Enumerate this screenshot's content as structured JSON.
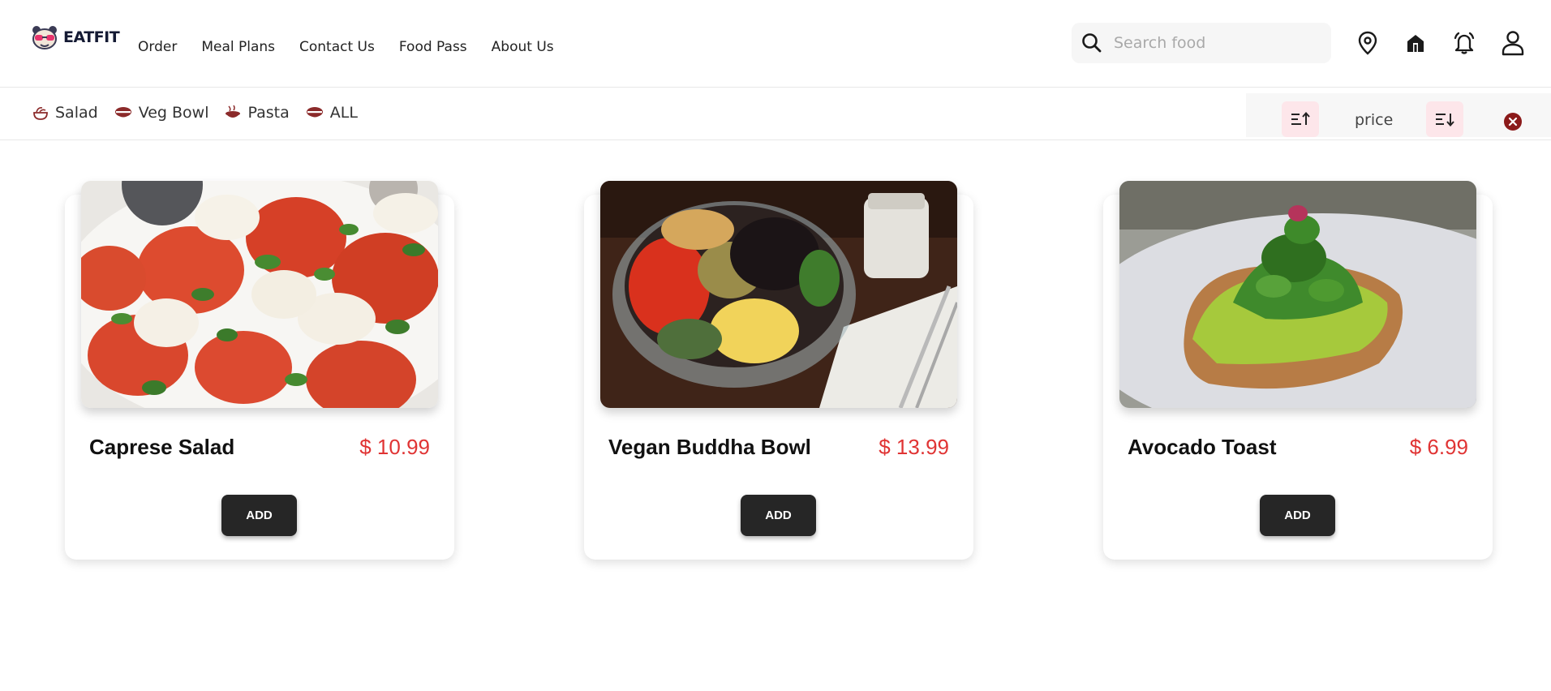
{
  "brand": {
    "name": "EATFIT"
  },
  "nav": {
    "items": [
      "Order",
      "Meal Plans",
      "Contact Us",
      "Food Pass",
      "About Us"
    ]
  },
  "search": {
    "placeholder": "Search food",
    "value": ""
  },
  "header_icons": [
    "location-pin-icon",
    "home-icon",
    "bell-icon",
    "user-icon"
  ],
  "categories": [
    {
      "label": "Salad",
      "icon": "salad-icon"
    },
    {
      "label": "Veg Bowl",
      "icon": "bowl-icon"
    },
    {
      "label": "Pasta",
      "icon": "pasta-icon"
    },
    {
      "label": "ALL",
      "icon": "bowl-icon"
    }
  ],
  "sort": {
    "label": "price"
  },
  "products": [
    {
      "name": "Caprese Salad",
      "price": "$ 10.99",
      "button": "ADD"
    },
    {
      "name": "Vegan Buddha Bowl",
      "price": "$ 13.99",
      "button": "ADD"
    },
    {
      "name": "Avocado Toast",
      "price": "$ 6.99",
      "button": "ADD"
    }
  ],
  "colors": {
    "accent": "#e03434",
    "category_icon": "#8b2a2a",
    "sort_button_bg": "#fde6ea",
    "add_button": "#262626"
  }
}
